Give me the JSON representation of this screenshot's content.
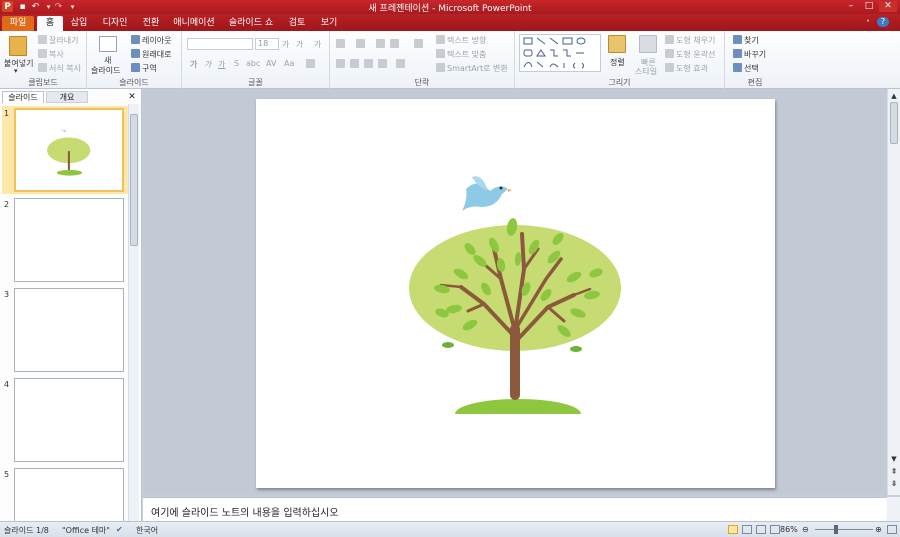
{
  "window": {
    "title": "새 프레젠테이션 - Microsoft PowerPoint"
  },
  "tabs": [
    "파일",
    "홈",
    "삽입",
    "디자인",
    "전환",
    "애니메이션",
    "슬라이드 쇼",
    "검토",
    "보기"
  ],
  "active_tab": "홈",
  "ribbon": {
    "clipboard": {
      "paste": "붙여넣기",
      "cut": "잘라내기",
      "copy": "복사",
      "format_painter": "서식 복사",
      "label": "클립보드"
    },
    "slides": {
      "new_slide_line1": "새",
      "new_slide_line2": "슬라이드",
      "layout": "레이아웃",
      "reset": "원래대로",
      "section": "구역",
      "label": "슬라이드"
    },
    "font": {
      "font_size": "18",
      "label": "글꼴",
      "bold": "가",
      "italic": "가",
      "underline": "가",
      "strike": "S",
      "shadow": "abc",
      "spacing": "AV",
      "case": "Aa",
      "grow": "가",
      "shrink": "가",
      "clear": "가"
    },
    "paragraph": {
      "text_direction": "텍스트 방향",
      "text_align": "텍스트 맞춤",
      "smartart": "SmartArt로 변환",
      "label": "단락"
    },
    "drawing": {
      "arrange": "정렬",
      "quick_styles_line1": "빠른",
      "quick_styles_line2": "스타일",
      "shape_fill": "도형 채우기",
      "shape_outline": "도형 윤곽선",
      "shape_effects": "도형 효과",
      "label": "그리기"
    },
    "editing": {
      "find": "찾기",
      "replace": "바꾸기",
      "select": "선택",
      "label": "편집"
    }
  },
  "panel": {
    "tab_slides": "슬라이드",
    "tab_outline": "개요",
    "slide_numbers": [
      "1",
      "2",
      "3",
      "4",
      "5"
    ]
  },
  "notes": {
    "placeholder": "여기에 슬라이드 노트의 내용을 입력하십시오"
  },
  "status": {
    "slide_indicator": "슬라이드 1/8",
    "theme": "\"Office 테마\"",
    "language": "한국어",
    "zoom": "86%"
  },
  "colors": {
    "title_red": "#b82024",
    "file_tab_orange": "#e06a1a",
    "selection_gold": "#f2c15a",
    "tree_canopy": "#c6dc72",
    "leaf_green": "#8dc63f",
    "trunk_brown": "#8b5a3c",
    "bird_blue": "#8ec9e6"
  }
}
